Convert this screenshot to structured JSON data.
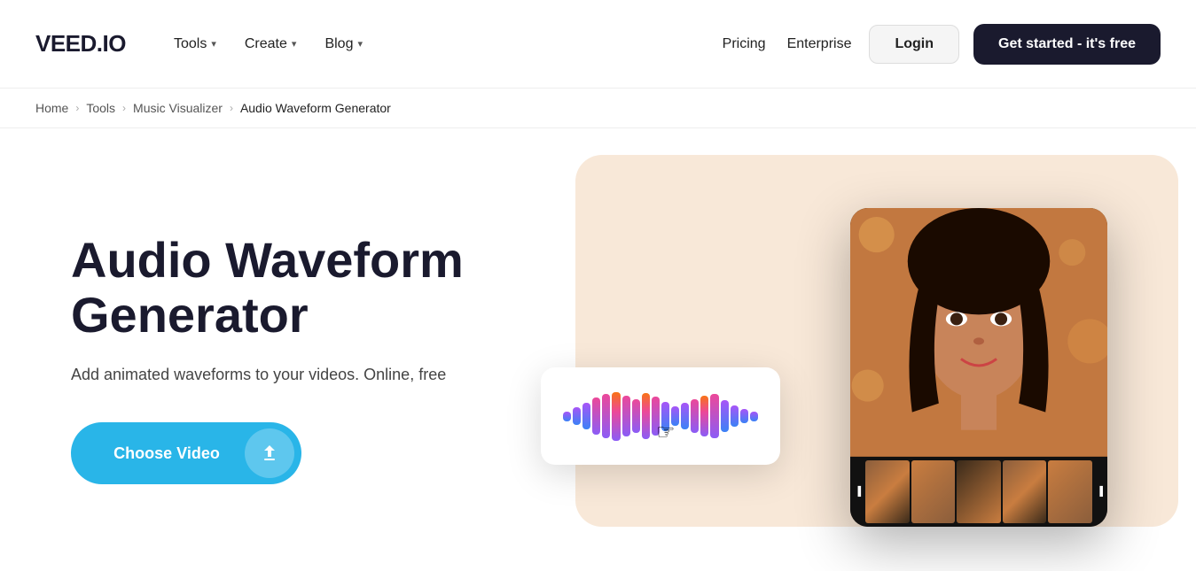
{
  "navbar": {
    "logo": "VEED.IO",
    "nav_items": [
      {
        "label": "Tools",
        "has_dropdown": true
      },
      {
        "label": "Create",
        "has_dropdown": true
      },
      {
        "label": "Blog",
        "has_dropdown": true
      }
    ],
    "right_links": [
      {
        "label": "Pricing"
      },
      {
        "label": "Enterprise"
      }
    ],
    "login_label": "Login",
    "cta_label": "Get started - it's free"
  },
  "breadcrumb": {
    "items": [
      "Home",
      "Tools",
      "Music Visualizer",
      "Audio Waveform Generator"
    ]
  },
  "hero": {
    "title": "Audio Waveform Generator",
    "subtitle": "Add animated waveforms to your videos. Online, free",
    "cta_label": "Choose Video",
    "upload_icon": "⬆"
  },
  "icons": {
    "chevron": "›",
    "breadcrumb_sep": "›",
    "upload": "↑",
    "cursor": "☞"
  }
}
